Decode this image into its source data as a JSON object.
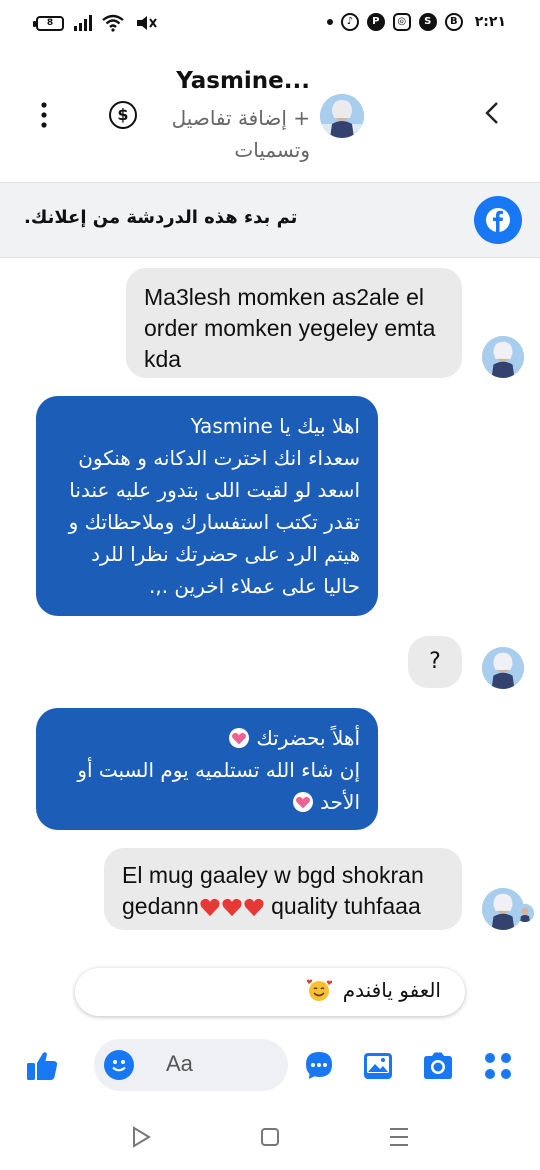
{
  "status_bar": {
    "battery": "8",
    "time": "٢:٢١",
    "icons": [
      "battery-icon",
      "signal-icon",
      "wifi-icon",
      "mute-icon",
      "dot-icon",
      "tiktok-icon",
      "pinterest-icon",
      "instagram-icon",
      "shazam-icon",
      "b-icon"
    ]
  },
  "header": {
    "contact_name": "Yasmine...",
    "subtitle": "+ إضافة تفاصيل وتسميات",
    "back_icon": "chevron-left-icon",
    "payment_icon": "dollar-icon",
    "dollar_glyph": "$",
    "more_icon": "kebab-icon"
  },
  "ad_banner": {
    "text": "تم بدء هذه الدردشة من إعلانك.",
    "icon": "facebook-icon"
  },
  "messages": [
    {
      "direction": "incoming",
      "text": "Ma3lesh momken as2ale el order momken yegeley emta kda"
    },
    {
      "direction": "outgoing",
      "lines": [
        "اهلا بيك يا Yasmine",
        "سعداء انك اخترت الدكانه و هنكون",
        "اسعد لو لقيت اللى بتدور عليه عندنا",
        "تقدر تكتب استفسارك وملاحظاتك و",
        "هيتم الرد على حضرتك نظرا للرد",
        "حاليا على عملاء اخرين .,."
      ]
    },
    {
      "direction": "incoming",
      "text": "?"
    },
    {
      "direction": "outgoing",
      "lines": [
        "أهلاً بحضرتك",
        "إن شاء الله تستلميه يوم السبت أو",
        "الأحد"
      ]
    },
    {
      "direction": "incoming",
      "line1": "El mug gaaley w bgd shokran",
      "line2_a": "gedann",
      "line2_b": " quality tuhfaaa"
    }
  ],
  "draft": {
    "text": "العفو يافندم"
  },
  "composer": {
    "placeholder": "Aa",
    "icons": [
      "like-icon",
      "emoji-icon",
      "messenger-icon",
      "gallery-icon",
      "camera-icon",
      "apps-icon"
    ]
  },
  "colors": {
    "outgoing_bubble": "#1c5db7",
    "incoming_bubble": "#eaeaea",
    "accent": "#1877f2",
    "banner_bg": "#f1f2f4"
  }
}
